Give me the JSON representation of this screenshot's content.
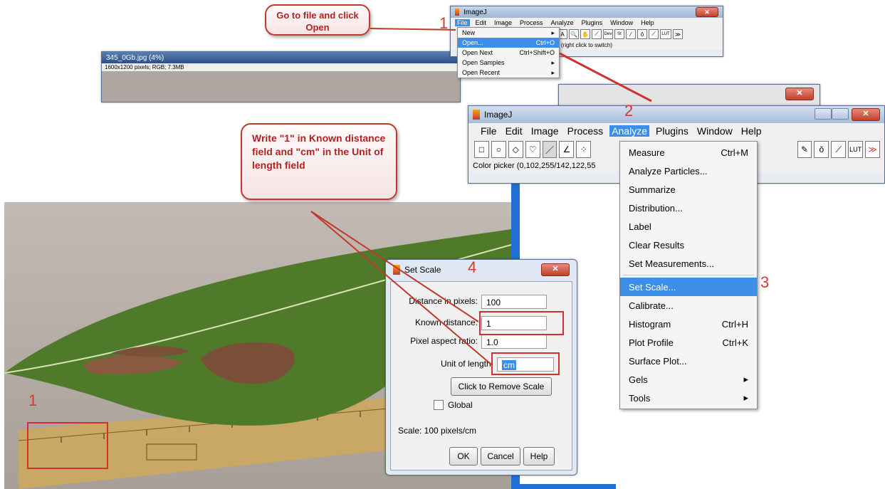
{
  "callouts": {
    "open": "Go to file and click Open",
    "known": "Write \"1\" in Known distance field and \"cm\" in the Unit of length field"
  },
  "steps": {
    "s1": "1",
    "s2": "2",
    "s3": "3",
    "s4": "4",
    "s1b": "1"
  },
  "win1": {
    "title": "ImageJ",
    "menus": [
      "File",
      "Edit",
      "Image",
      "Process",
      "Analyze",
      "Plugins",
      "Window",
      "Help"
    ],
    "status": "(right click to switch)",
    "tools": [
      "□",
      "○",
      "◇",
      "♡",
      "／",
      "∠",
      "✢",
      "A",
      "🔍",
      "✋",
      "⟋",
      "Dev",
      "St",
      "⁄",
      "ǒ",
      "⟋",
      "LUT",
      "≫"
    ]
  },
  "file_menu": {
    "items": [
      {
        "label": "New",
        "shortcut": "",
        "arrow": "▸"
      },
      {
        "label": "Open...",
        "shortcut": "Ctrl+O",
        "arrow": ""
      },
      {
        "label": "Open Next",
        "shortcut": "Ctrl+Shift+O",
        "arrow": ""
      },
      {
        "label": "Open Samples",
        "shortcut": "",
        "arrow": "▸"
      },
      {
        "label": "Open Recent",
        "shortcut": "",
        "arrow": "▸"
      }
    ]
  },
  "image_window": {
    "title": "345_0Gb.jpg (4%)",
    "info": "1600x1200 pixels; RGB; 7.3MB"
  },
  "win2": {
    "title": "ImageJ",
    "menus": [
      "File",
      "Edit",
      "Image",
      "Process",
      "Analyze",
      "Plugins",
      "Window",
      "Help"
    ],
    "status": "Color picker (0,102,255/142,122,55",
    "tools": [
      "□",
      "○",
      "◇",
      "♡",
      "／",
      "∠",
      "⁘"
    ],
    "tools_right": [
      "✎",
      "ǒ",
      "⟋",
      "LUT",
      "≫"
    ]
  },
  "analyze_menu": {
    "items": [
      {
        "label": "Measure",
        "shortcut": "Ctrl+M"
      },
      {
        "label": "Analyze Particles...",
        "shortcut": ""
      },
      {
        "label": "Summarize",
        "shortcut": ""
      },
      {
        "label": "Distribution...",
        "shortcut": ""
      },
      {
        "label": "Label",
        "shortcut": ""
      },
      {
        "label": "Clear Results",
        "shortcut": ""
      },
      {
        "label": "Set Measurements...",
        "shortcut": ""
      }
    ],
    "items2": [
      {
        "label": "Set Scale...",
        "shortcut": ""
      },
      {
        "label": "Calibrate...",
        "shortcut": ""
      },
      {
        "label": "Histogram",
        "shortcut": "Ctrl+H"
      },
      {
        "label": "Plot Profile",
        "shortcut": "Ctrl+K"
      },
      {
        "label": "Surface Plot...",
        "shortcut": ""
      },
      {
        "label": "Gels",
        "shortcut": "▸"
      },
      {
        "label": "Tools",
        "shortcut": "▸"
      }
    ]
  },
  "dialog": {
    "title": "Set Scale",
    "distance_label": "Distance in pixels:",
    "distance_value": "100",
    "known_label": "Known distance:",
    "known_value": "1",
    "aspect_label": "Pixel aspect ratio:",
    "aspect_value": "1.0",
    "unit_label": "Unit of length:",
    "unit_value": "cm",
    "remove_button": "Click to Remove Scale",
    "global_label": "Global",
    "scale_text": "Scale: 100 pixels/cm",
    "ok": "OK",
    "cancel": "Cancel",
    "help": "Help"
  }
}
